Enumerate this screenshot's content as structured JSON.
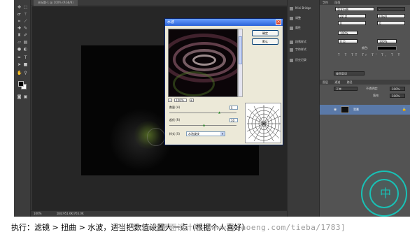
{
  "document": {
    "tab_label": "未标题-1 @ 100% (RGB/8)"
  },
  "toolbox": {
    "tools": [
      "move-tool-icon",
      "marquee-tool-icon",
      "lasso-tool-icon",
      "magic-wand-icon",
      "crop-tool-icon",
      "eyedropper-icon",
      "healing-brush-icon",
      "brush-tool-icon",
      "clone-stamp-icon",
      "history-brush-icon",
      "eraser-icon",
      "gradient-tool-icon",
      "blur-tool-icon",
      "dodge-tool-icon",
      "pen-tool-icon",
      "type-tool-icon",
      "path-selection-icon",
      "shape-tool-icon",
      "hand-tool-icon",
      "zoom-tool-icon"
    ]
  },
  "status": {
    "zoom": "100%",
    "doc_info": "文档:951.6K/765.0K"
  },
  "mid_panel": {
    "items": [
      "Mini Bridge",
      "调整",
      "属性",
      "段落样式",
      "字符样式",
      "历史记录"
    ]
  },
  "right_panel": {
    "tabs_top": [
      "字符",
      "段落"
    ],
    "font_family": "华文行楷",
    "font_style": "-",
    "font_size": "22 点",
    "leading": "(自动)",
    "kerning": "0",
    "tracking": "0",
    "vertical_scale": "100%",
    "horizontal_scale": "100%",
    "baseline": "0 点",
    "color_label": "颜色:",
    "language": "美国英语",
    "layer_tabs": [
      "图层",
      "通道",
      "路径"
    ],
    "blend_mode": "正常",
    "opacity_label": "不透明度:",
    "opacity": "100%",
    "fill_label": "填充:",
    "fill": "100%",
    "layer_name": "背景"
  },
  "dialog": {
    "title": "水波",
    "ok_label": "确定",
    "cancel_label": "默认",
    "zoom_minus": "-",
    "zoom_value": "100%",
    "zoom_plus": "+",
    "amount_label": "数量 (A)",
    "amount_value": "5",
    "ridges_label": "起伏 (R)",
    "ridges_value": "10",
    "style_label": "样式 (S)",
    "style_value": "水池波纹"
  },
  "caption": {
    "text": "执行：滤镜 > 扭曲 > 水波，适当把数值设置大一点（根据个人喜好）",
    "watermark": "PhotoShop平面设计吧 [www.jiaoeng.com/tieba/1783]"
  },
  "logo_char": "中",
  "colors": {
    "dialog_titlebar": "#2a62d8",
    "selected_layer": "#5a79a8",
    "logo_teal": "#18c2b6"
  }
}
